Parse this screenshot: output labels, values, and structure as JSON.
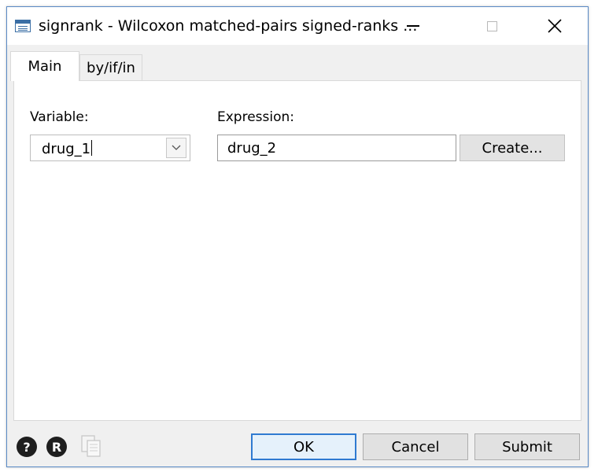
{
  "window": {
    "title": "signrank - Wilcoxon matched-pairs signed-ranks ...",
    "icon": "stata-dialog-icon",
    "controls": {
      "minimize": "minimize-icon",
      "maximize": "maximize-icon",
      "close": "close-icon"
    }
  },
  "tabs": [
    {
      "label": "Main",
      "active": true
    },
    {
      "label": "by/if/in",
      "active": false
    }
  ],
  "main": {
    "variable_label": "Variable:",
    "variable_value": "drug_1",
    "expression_label": "Expression:",
    "expression_value": "drug_2",
    "create_button": "Create..."
  },
  "footer": {
    "help_glyph": "?",
    "r_glyph": "R",
    "ok": "OK",
    "cancel": "Cancel",
    "submit": "Submit"
  },
  "colors": {
    "accent": "#2f7ad1",
    "window_border": "#5a8ac6",
    "dialog_bg": "#f0f0f0"
  }
}
